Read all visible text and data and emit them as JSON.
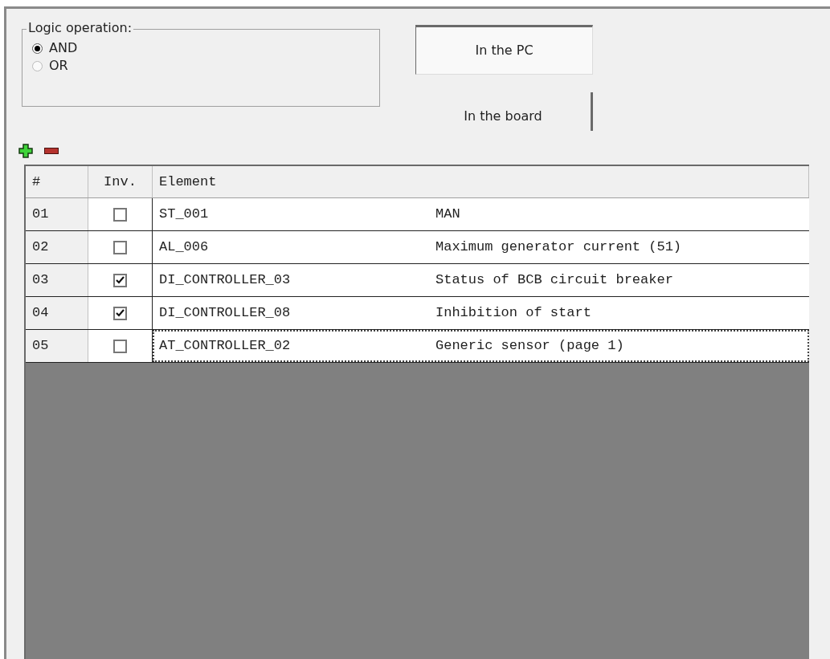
{
  "logic_operation": {
    "title": "Logic operation:",
    "options": [
      {
        "label": "AND",
        "selected": true
      },
      {
        "label": "OR",
        "selected": false
      }
    ]
  },
  "location_buttons": [
    {
      "label": "In the PC",
      "selected": true
    },
    {
      "label": "In the board",
      "selected": false
    }
  ],
  "table": {
    "columns": [
      "#",
      "Inv.",
      "Element"
    ],
    "rows": [
      {
        "number": "01",
        "inverted": false,
        "element": "ST_001",
        "description": "MAN",
        "selected": false
      },
      {
        "number": "02",
        "inverted": false,
        "element": "AL_006",
        "description": "Maximum generator current (51)",
        "selected": false
      },
      {
        "number": "03",
        "inverted": true,
        "element": "DI_CONTROLLER_03",
        "description": "Status of BCB circuit breaker",
        "selected": false
      },
      {
        "number": "04",
        "inverted": true,
        "element": "DI_CONTROLLER_08",
        "description": "Inhibition of start",
        "selected": false
      },
      {
        "number": "05",
        "inverted": false,
        "element": "AT_CONTROLLER_02",
        "description": "Generic sensor (page 1)",
        "selected": true
      }
    ]
  }
}
